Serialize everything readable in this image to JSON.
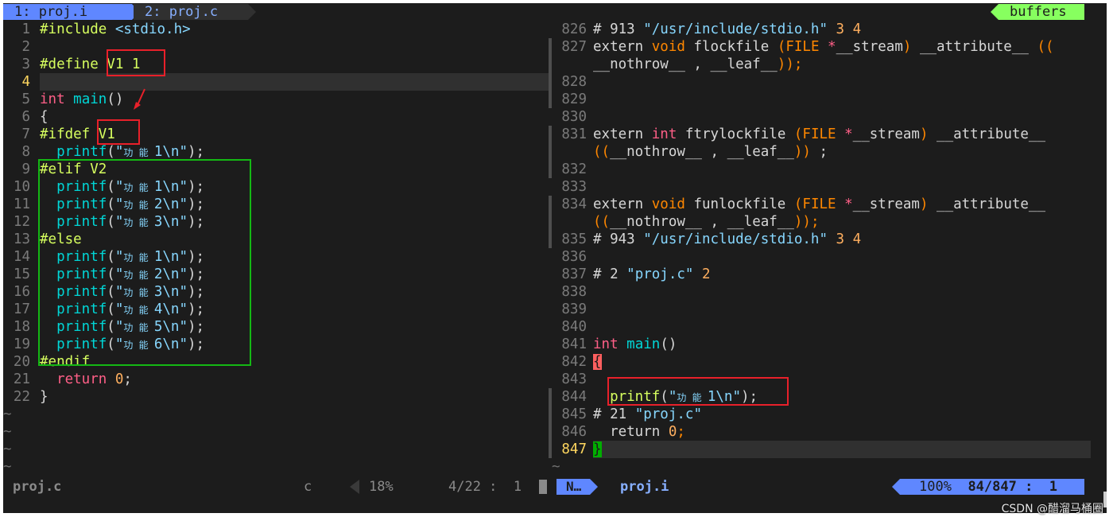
{
  "tabline": {
    "tab1": "1: proj.i",
    "tab2": "2: proj.c",
    "buffers_label": "buffers"
  },
  "left_pane": {
    "lines": [
      {
        "n": "1",
        "tokens": [
          [
            "pp",
            "#include "
          ],
          [
            "str",
            "<stdio.h>"
          ]
        ]
      },
      {
        "n": "2",
        "tokens": []
      },
      {
        "n": "3",
        "tokens": [
          [
            "pp",
            "#define "
          ],
          [
            "pp",
            "V1 1"
          ]
        ]
      },
      {
        "n": "4",
        "tokens": [],
        "current": true
      },
      {
        "n": "5",
        "tokens": [
          [
            "kw",
            "int "
          ],
          [
            "fn",
            "main"
          ],
          [
            "id",
            "()"
          ]
        ]
      },
      {
        "n": "6",
        "tokens": [
          [
            "id",
            "{"
          ]
        ]
      },
      {
        "n": "7",
        "tokens": [
          [
            "pp",
            "#ifdef "
          ],
          [
            "pp",
            "V1"
          ]
        ]
      },
      {
        "n": "8",
        "tokens": [
          [
            "id",
            "  "
          ],
          [
            "fn",
            "printf"
          ],
          [
            "id",
            "("
          ],
          [
            "str",
            "\""
          ],
          [
            "cn",
            "功 能 "
          ],
          [
            "str",
            "1\\n\""
          ],
          [
            "id",
            ");"
          ]
        ]
      },
      {
        "n": "9",
        "tokens": [
          [
            "pp",
            "#elif V2"
          ]
        ]
      },
      {
        "n": "10",
        "tokens": [
          [
            "id",
            "  "
          ],
          [
            "fn",
            "printf"
          ],
          [
            "id",
            "("
          ],
          [
            "str",
            "\""
          ],
          [
            "cn",
            "功 能 "
          ],
          [
            "str",
            "1\\n\""
          ],
          [
            "id",
            ");"
          ]
        ]
      },
      {
        "n": "11",
        "tokens": [
          [
            "id",
            "  "
          ],
          [
            "fn",
            "printf"
          ],
          [
            "id",
            "("
          ],
          [
            "str",
            "\""
          ],
          [
            "cn",
            "功 能 "
          ],
          [
            "str",
            "2\\n\""
          ],
          [
            "id",
            ");"
          ]
        ]
      },
      {
        "n": "12",
        "tokens": [
          [
            "id",
            "  "
          ],
          [
            "fn",
            "printf"
          ],
          [
            "id",
            "("
          ],
          [
            "str",
            "\""
          ],
          [
            "cn",
            "功 能 "
          ],
          [
            "str",
            "3\\n\""
          ],
          [
            "id",
            ");"
          ]
        ]
      },
      {
        "n": "13",
        "tokens": [
          [
            "pp",
            "#else"
          ]
        ]
      },
      {
        "n": "14",
        "tokens": [
          [
            "id",
            "  "
          ],
          [
            "fn",
            "printf"
          ],
          [
            "id",
            "("
          ],
          [
            "str",
            "\""
          ],
          [
            "cn",
            "功 能 "
          ],
          [
            "str",
            "1\\n\""
          ],
          [
            "id",
            ");"
          ]
        ]
      },
      {
        "n": "15",
        "tokens": [
          [
            "id",
            "  "
          ],
          [
            "fn",
            "printf"
          ],
          [
            "id",
            "("
          ],
          [
            "str",
            "\""
          ],
          [
            "cn",
            "功 能 "
          ],
          [
            "str",
            "2\\n\""
          ],
          [
            "id",
            ");"
          ]
        ]
      },
      {
        "n": "16",
        "tokens": [
          [
            "id",
            "  "
          ],
          [
            "fn",
            "printf"
          ],
          [
            "id",
            "("
          ],
          [
            "str",
            "\""
          ],
          [
            "cn",
            "功 能 "
          ],
          [
            "str",
            "3\\n\""
          ],
          [
            "id",
            ");"
          ]
        ]
      },
      {
        "n": "17",
        "tokens": [
          [
            "id",
            "  "
          ],
          [
            "fn",
            "printf"
          ],
          [
            "id",
            "("
          ],
          [
            "str",
            "\""
          ],
          [
            "cn",
            "功 能 "
          ],
          [
            "str",
            "4\\n\""
          ],
          [
            "id",
            ");"
          ]
        ]
      },
      {
        "n": "18",
        "tokens": [
          [
            "id",
            "  "
          ],
          [
            "fn",
            "printf"
          ],
          [
            "id",
            "("
          ],
          [
            "str",
            "\""
          ],
          [
            "cn",
            "功 能 "
          ],
          [
            "str",
            "5\\n\""
          ],
          [
            "id",
            ");"
          ]
        ]
      },
      {
        "n": "19",
        "tokens": [
          [
            "id",
            "  "
          ],
          [
            "fn",
            "printf"
          ],
          [
            "id",
            "("
          ],
          [
            "str",
            "\""
          ],
          [
            "cn",
            "功 能 "
          ],
          [
            "str",
            "6\\n\""
          ],
          [
            "id",
            ");"
          ]
        ]
      },
      {
        "n": "20",
        "tokens": [
          [
            "pp",
            "#endif"
          ]
        ]
      },
      {
        "n": "21",
        "tokens": [
          [
            "id",
            "  "
          ],
          [
            "kw",
            "return "
          ],
          [
            "num",
            "0"
          ],
          [
            "id",
            ";"
          ]
        ]
      },
      {
        "n": "22",
        "tokens": [
          [
            "id",
            "}"
          ]
        ]
      }
    ],
    "tilde_rows": [
      "~",
      "~",
      "~",
      "~"
    ]
  },
  "right_pane": {
    "lines": [
      {
        "n": "826",
        "tokens": [
          [
            "id",
            "# 913 "
          ],
          [
            "str",
            "\"/usr/include/stdio.h\""
          ],
          [
            "num",
            " 3 4"
          ]
        ]
      },
      {
        "n": "827",
        "tokens": [
          [
            "id",
            "extern "
          ],
          [
            "type",
            "void "
          ],
          [
            "id",
            "flockfile "
          ],
          [
            "type",
            "(FILE "
          ],
          [
            "kw",
            "*"
          ],
          [
            "id",
            "__stream"
          ],
          [
            "type",
            ") "
          ],
          [
            "id",
            "__attribute__ "
          ],
          [
            "type",
            "(("
          ]
        ]
      },
      {
        "n": "",
        "tokens": [
          [
            "id",
            "__nothrow__ , __leaf__"
          ],
          [
            "type",
            "));"
          ]
        ]
      },
      {
        "n": "828",
        "tokens": []
      },
      {
        "n": "829",
        "tokens": []
      },
      {
        "n": "830",
        "tokens": []
      },
      {
        "n": "831",
        "tokens": [
          [
            "id",
            "extern "
          ],
          [
            "kw",
            "int "
          ],
          [
            "id",
            "ftrylockfile "
          ],
          [
            "type",
            "(FILE "
          ],
          [
            "kw",
            "*"
          ],
          [
            "id",
            "__stream"
          ],
          [
            "type",
            ") "
          ],
          [
            "id",
            "__attribute__"
          ]
        ]
      },
      {
        "n": "",
        "tokens": [
          [
            "type",
            "(("
          ],
          [
            "id",
            "__nothrow__ , __leaf__"
          ],
          [
            "type",
            "))"
          ],
          [
            "id",
            " ;"
          ]
        ]
      },
      {
        "n": "832",
        "tokens": []
      },
      {
        "n": "833",
        "tokens": []
      },
      {
        "n": "834",
        "tokens": [
          [
            "id",
            "extern "
          ],
          [
            "type",
            "void "
          ],
          [
            "id",
            "funlockfile "
          ],
          [
            "type",
            "(FILE "
          ],
          [
            "kw",
            "*"
          ],
          [
            "id",
            "__stream"
          ],
          [
            "type",
            ") "
          ],
          [
            "id",
            "__attribute__"
          ]
        ]
      },
      {
        "n": "",
        "tokens": [
          [
            "type",
            "(("
          ],
          [
            "id",
            "__nothrow__ , __leaf__"
          ],
          [
            "type",
            "));"
          ]
        ]
      },
      {
        "n": "835",
        "tokens": [
          [
            "id",
            "# 943 "
          ],
          [
            "str",
            "\"/usr/include/stdio.h\""
          ],
          [
            "num",
            " 3 4"
          ]
        ]
      },
      {
        "n": "836",
        "tokens": []
      },
      {
        "n": "837",
        "tokens": [
          [
            "id",
            "# 2 "
          ],
          [
            "str",
            "\"proj.c\""
          ],
          [
            "num",
            " 2"
          ]
        ]
      },
      {
        "n": "838",
        "tokens": []
      },
      {
        "n": "839",
        "tokens": []
      },
      {
        "n": "840",
        "tokens": []
      },
      {
        "n": "841",
        "tokens": [
          [
            "kw",
            "int "
          ],
          [
            "fn",
            "main"
          ],
          [
            "id",
            "()"
          ]
        ]
      },
      {
        "n": "842",
        "tokens": [
          [
            "brace-hl",
            "{"
          ]
        ]
      },
      {
        "n": "843",
        "tokens": []
      },
      {
        "n": "844",
        "tokens": [
          [
            "id",
            "  "
          ],
          [
            "pp",
            "printf"
          ],
          [
            "id",
            "("
          ],
          [
            "str",
            "\""
          ],
          [
            "cn",
            "功 能 "
          ],
          [
            "str",
            "1\\n\""
          ],
          [
            "id",
            ");"
          ]
        ]
      },
      {
        "n": "845",
        "tokens": [
          [
            "id",
            "# 21 "
          ],
          [
            "str",
            "\"proj.c\""
          ]
        ]
      },
      {
        "n": "846",
        "tokens": [
          [
            "id",
            "  return "
          ],
          [
            "num",
            "0"
          ],
          [
            "type",
            ";"
          ]
        ]
      },
      {
        "n": "847",
        "tokens": [
          [
            "brace-g",
            "}"
          ]
        ],
        "current": true
      }
    ],
    "tilde_rows": [
      "~"
    ]
  },
  "statusline": {
    "left_file": "proj.c",
    "left_filetype": "c",
    "left_percent": "18%",
    "left_position": "4/22 :  1",
    "mode": "N…",
    "right_file": "proj.i",
    "right_percent": "100%",
    "right_position": "84/847 :  1"
  },
  "watermark": "CSDN @醋溜马桶圈",
  "colors": {
    "background": "#1c1c1c",
    "tab_active": "#5f87ff",
    "buffers": "#87ff5f",
    "annotation_red": "#e8202a",
    "annotation_green": "#14b814"
  }
}
